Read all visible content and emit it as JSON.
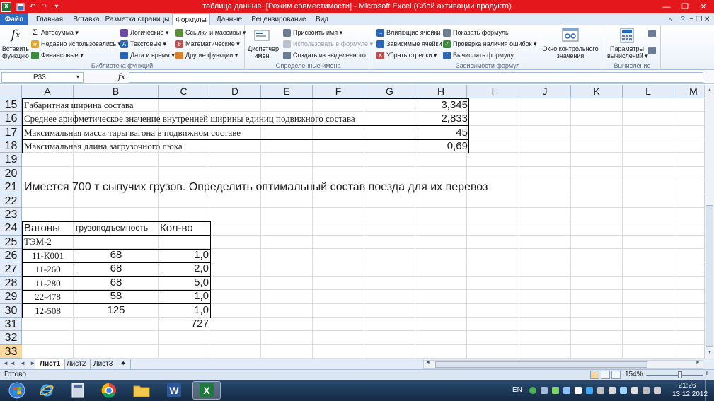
{
  "window": {
    "title": "таблица данные. [Режим совместимости] - Microsoft Excel (Сбой активации продукта)"
  },
  "ribbon_tabs": [
    "Файл",
    "Главная",
    "Вставка",
    "Разметка страницы",
    "Формулы",
    "Данные",
    "Рецензирование",
    "Вид"
  ],
  "active_tab": "Формулы",
  "ribbon": {
    "insert_function": "Вставить функцию",
    "func_lib": {
      "autosum": "Автосумма",
      "recent": "Недавно использовались",
      "financial": "Финансовые",
      "logical": "Логические",
      "text": "Текстовые",
      "datetime": "Дата и время",
      "lookup": "Ссылки и массивы",
      "math": "Математические",
      "other": "Другие функции",
      "label": "Библиотека функций"
    },
    "names": {
      "manager": "Диспетчер имен",
      "define": "Присвоить имя",
      "use_in_formula": "Использовать в формуле",
      "create_from_selection": "Создать из выделенного",
      "label": "Определенные имена"
    },
    "audit": {
      "precedents": "Влияющие ячейки",
      "dependents": "Зависимые ячейки",
      "remove_arrows": "Убрать стрелки",
      "show_formulas": "Показать формулы",
      "error_checking": "Проверка наличия ошибок",
      "evaluate": "Вычислить формулу",
      "watch_window": "Окно контрольного значения",
      "label": "Зависимости формул"
    },
    "calc": {
      "options": "Параметры вычислений",
      "label": "Вычисление"
    }
  },
  "formula_bar": {
    "name_box": "P33",
    "fx": "fx",
    "content": ""
  },
  "columns": [
    "A",
    "B",
    "C",
    "D",
    "E",
    "F",
    "G",
    "H",
    "I",
    "J",
    "K",
    "L",
    "M"
  ],
  "rows": [
    "15",
    "16",
    "17",
    "18",
    "19",
    "20",
    "21",
    "22",
    "23",
    "24",
    "25",
    "26",
    "27",
    "28",
    "29",
    "30",
    "31",
    "32",
    "33"
  ],
  "sheet": {
    "params": [
      {
        "label": "Габаритная ширина состава",
        "value": "3,345"
      },
      {
        "label": "Среднее арифметическое значение внутренней ширины единиц подвижного состава",
        "value": "2,833"
      },
      {
        "label": "Максимальная масса тары вагона в подвижном составе",
        "value": "45"
      },
      {
        "label": "Максимальная длина загрузочного люка",
        "value": "0,69"
      }
    ],
    "task": "Имеется 700 т сыпучих грузов. Определить оптимальный состав поезда для их перевоз",
    "table_header": {
      "wagons": "Вагоны",
      "capacity": "грузоподъемность",
      "count": "Кол-во"
    },
    "locomotive": "ТЭМ-2",
    "wagons": [
      {
        "name": "11-К001",
        "capacity": "68",
        "count": "1,0"
      },
      {
        "name": "11-260",
        "capacity": "68",
        "count": "2,0"
      },
      {
        "name": "11-280",
        "capacity": "68",
        "count": "5,0"
      },
      {
        "name": "22-478",
        "capacity": "58",
        "count": "1,0"
      },
      {
        "name": "12-508",
        "capacity": "125",
        "count": "1,0"
      }
    ],
    "total": "727"
  },
  "sheet_tabs": [
    "Лист1",
    "Лист2",
    "Лист3"
  ],
  "active_sheet": "Лист1",
  "status": {
    "ready": "Готово",
    "zoom": "154%"
  },
  "taskbar": {
    "lang": "EN",
    "time": "21:26",
    "date": "13.12.2012"
  },
  "colors": {
    "title_bar": "#e4171c",
    "file_tab": "#2b6cc4",
    "excel_green": "#1d7a3a",
    "selected_header": "#f9d99f"
  }
}
